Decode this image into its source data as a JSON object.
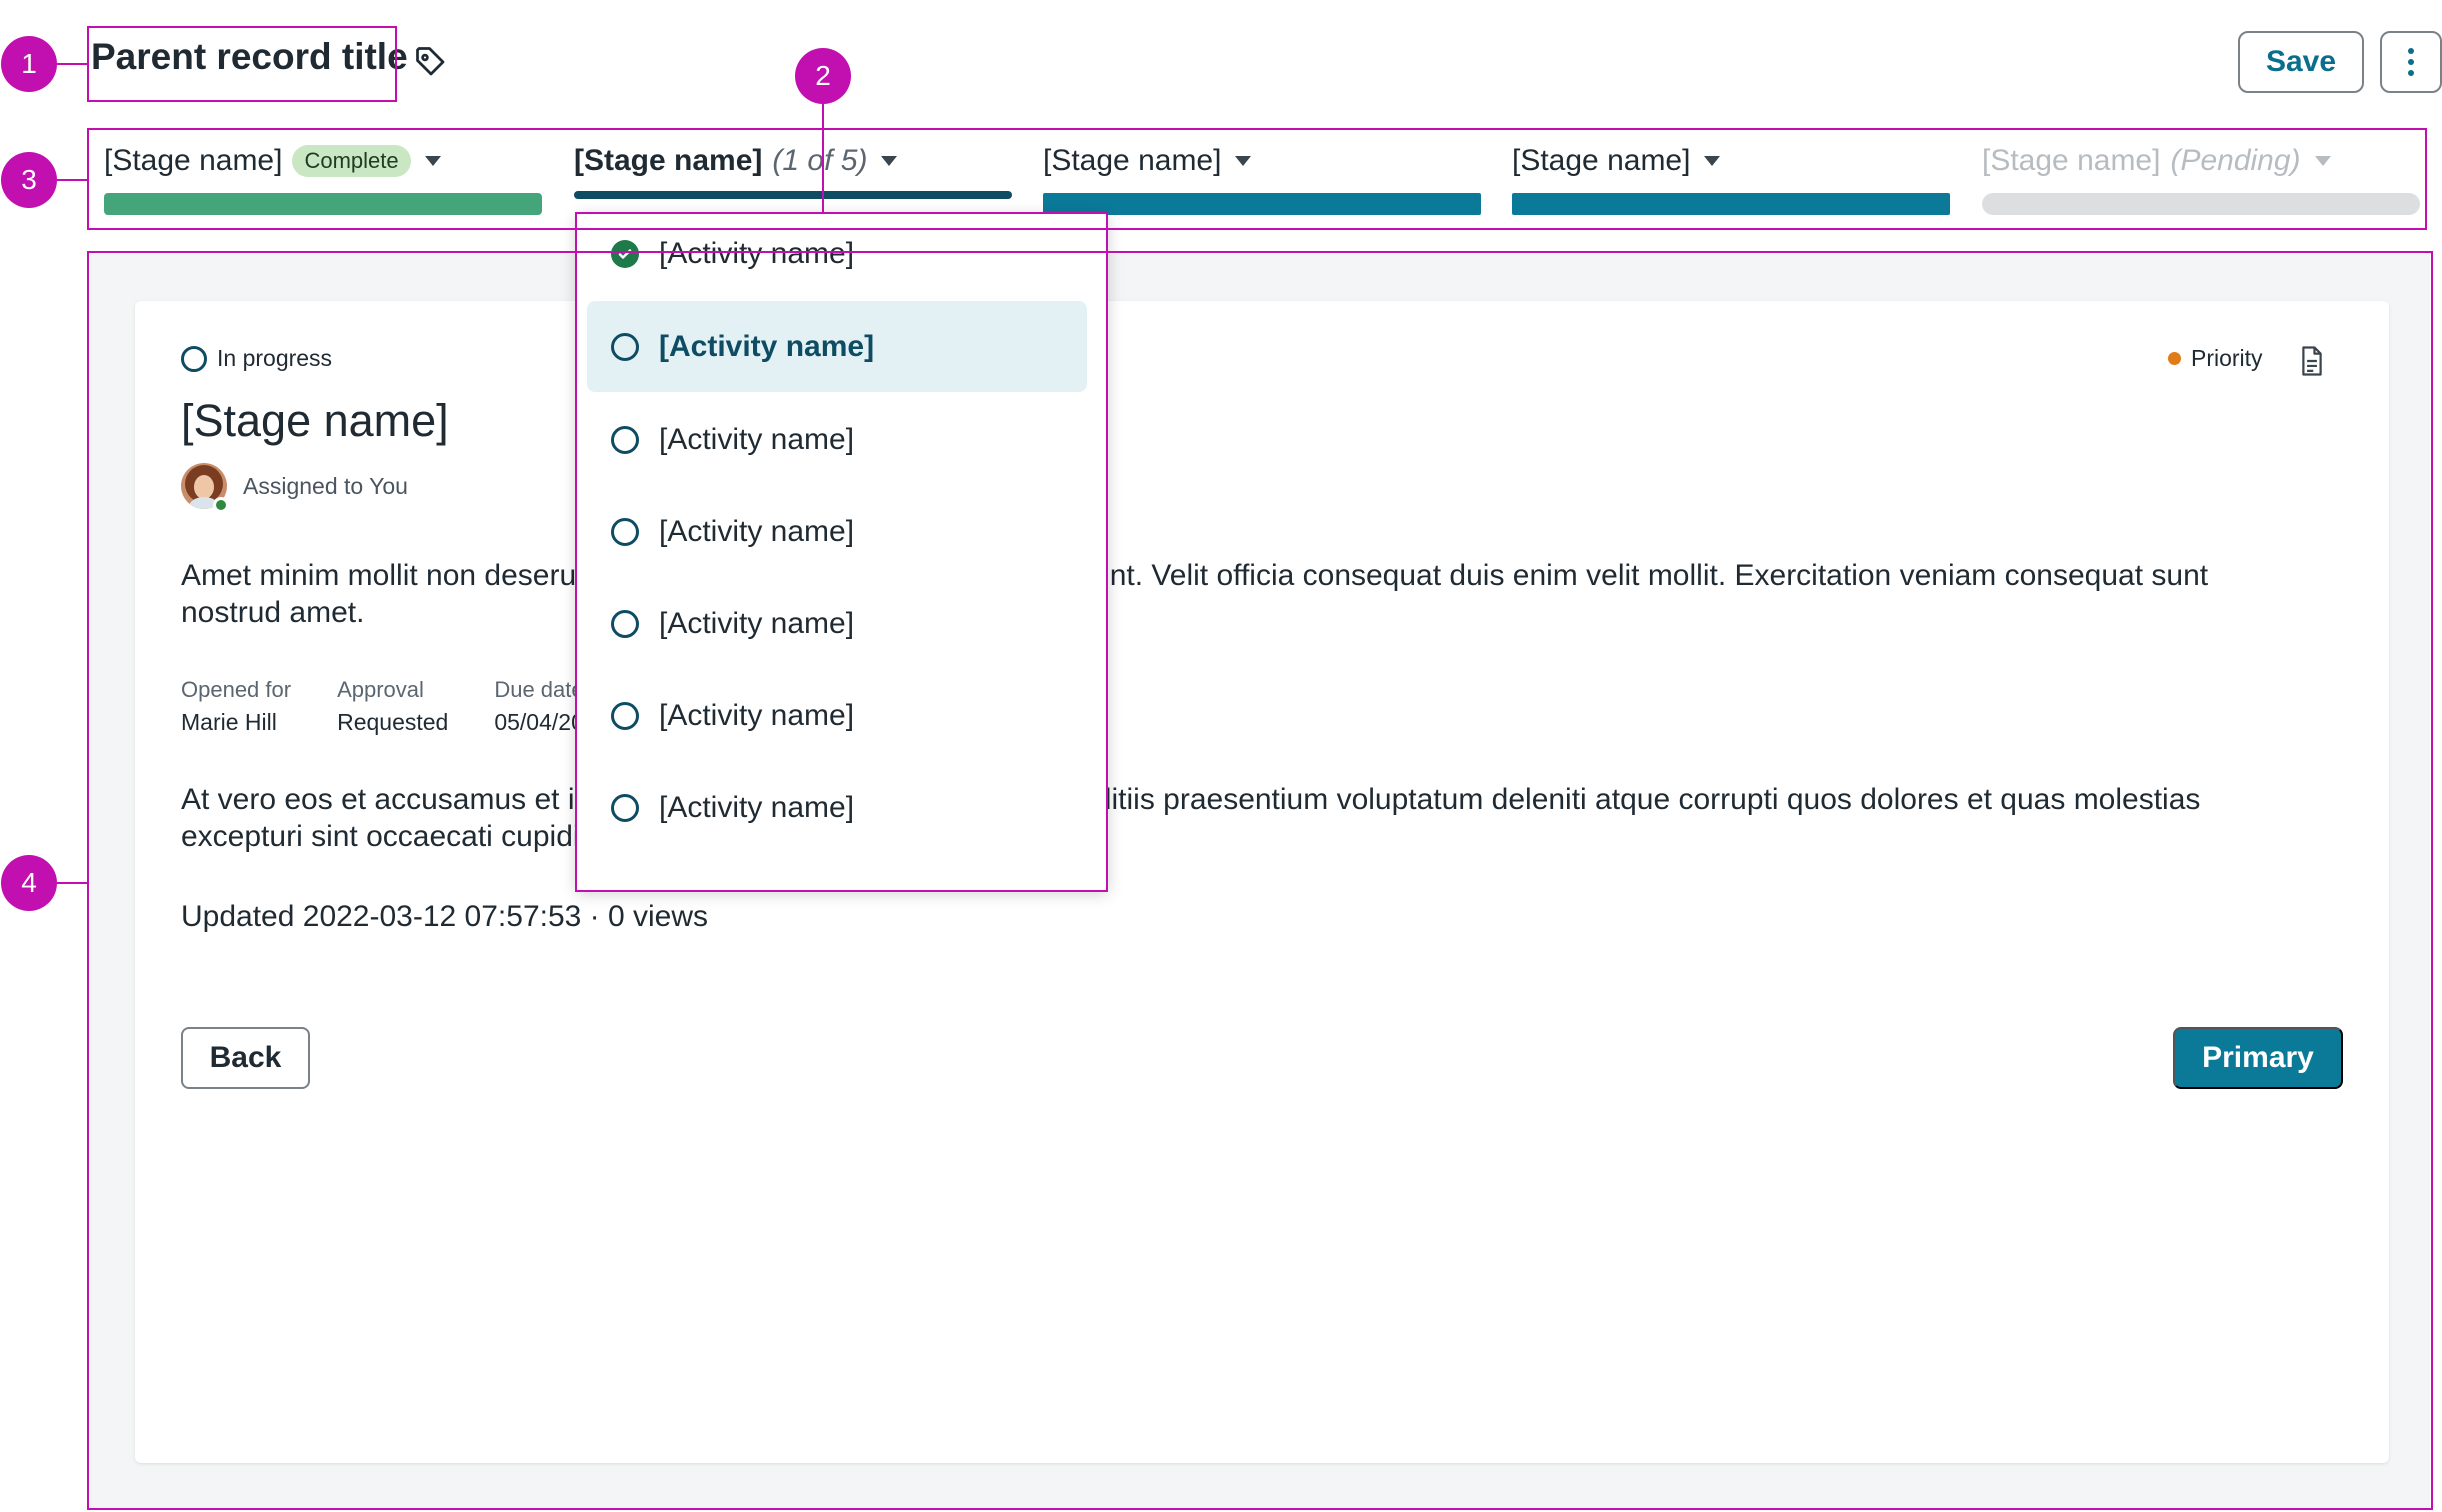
{
  "header": {
    "title": "Parent record title",
    "save_label": "Save"
  },
  "stages": [
    {
      "name": "[Stage name]",
      "badge": "Complete",
      "meta": "",
      "state": "complete",
      "color": "#44a57a"
    },
    {
      "name": "[Stage name]",
      "badge": "",
      "meta": "(1 of 5)",
      "state": "current",
      "color": "#0e4c63"
    },
    {
      "name": "[Stage name]",
      "badge": "",
      "meta": "",
      "state": "upcoming",
      "color": "#0b7a99"
    },
    {
      "name": "[Stage name]",
      "badge": "",
      "meta": "",
      "state": "upcoming",
      "color": "#0b7a99"
    },
    {
      "name": "[Stage name]",
      "badge": "",
      "meta": "(Pending)",
      "state": "pending",
      "color": "#dcdee0"
    }
  ],
  "activities": [
    {
      "label": "[Activity name]",
      "state": "done"
    },
    {
      "label": "[Activity name]",
      "state": "selected"
    },
    {
      "label": "[Activity name]",
      "state": "todo"
    },
    {
      "label": "[Activity name]",
      "state": "todo"
    },
    {
      "label": "[Activity name]",
      "state": "todo"
    },
    {
      "label": "[Activity name]",
      "state": "todo"
    },
    {
      "label": "[Activity name]",
      "state": "todo"
    }
  ],
  "card": {
    "status": "In progress",
    "title": "[Stage name]",
    "assigned": "Assigned to You",
    "priority": "Priority",
    "description_1": "Amet minim mollit non deserunt ullamco est sit aliqua dolor do amet sint. Velit officia consequat duis enim velit mollit. Exercitation veniam consequat sunt nostrud amet.",
    "fields": [
      {
        "label": "Opened for",
        "value": "Marie Hill"
      },
      {
        "label": "Approval",
        "value": "Requested"
      },
      {
        "label": "Due date",
        "value": "05/04/2022"
      }
    ],
    "description_2": "At vero eos et accusamus et iusto odio dignissimos ducimus qui blanditiis praesentium voluptatum deleniti atque corrupti quos dolores et quas molestias excepturi sint occaecati cupiditate non provident.",
    "updated": "Updated 2022-03-12 07:57:53 · 0 views",
    "back_label": "Back",
    "primary_label": "Primary"
  },
  "annotations": [
    "1",
    "2",
    "3",
    "4"
  ],
  "colors": {
    "annotation": "#c20fb0",
    "accent": "#0b7a99",
    "complete": "#44a57a",
    "priority": "#e07b18"
  }
}
